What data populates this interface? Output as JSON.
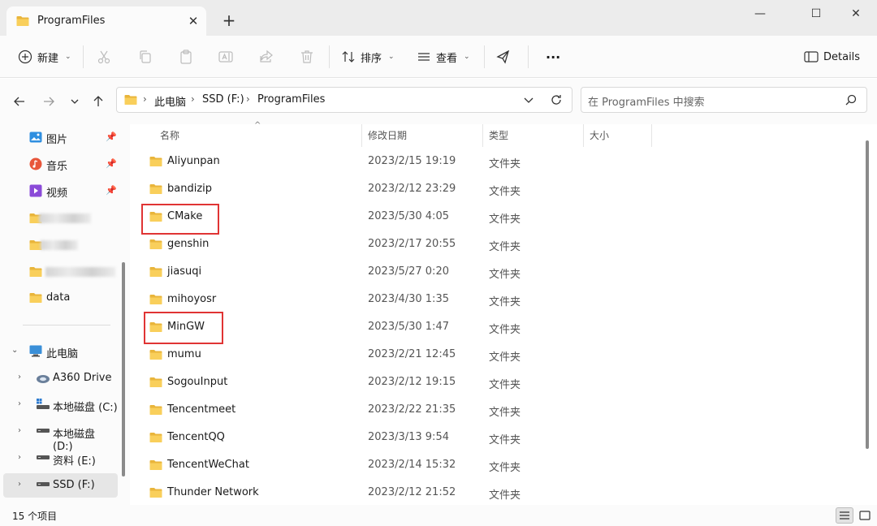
{
  "window": {
    "tab_title": "ProgramFiles",
    "tab_close": "✕",
    "new_tab": "+",
    "minimize": "—",
    "maximize": "☐",
    "close": "✕"
  },
  "toolbar": {
    "new_label": "新建",
    "sort_label": "排序",
    "view_label": "查看",
    "more_label": "···",
    "details_label": "Details"
  },
  "address": {
    "crumbs": [
      "此电脑",
      "SSD (F:)",
      "ProgramFiles"
    ],
    "search_placeholder": "在 ProgramFiles 中搜索"
  },
  "sidebar": {
    "quick": [
      {
        "label": "图片",
        "icon": "pictures-icon"
      },
      {
        "label": "音乐",
        "icon": "music-icon"
      },
      {
        "label": "视频",
        "icon": "videos-icon"
      }
    ],
    "data_folder": "data",
    "this_pc": "此电脑",
    "drives": [
      {
        "label": "A360 Drive",
        "icon": "cloud-drive-icon"
      },
      {
        "label": "本地磁盘 (C:)",
        "icon": "drive-icon"
      },
      {
        "label": "本地磁盘 (D:)",
        "icon": "drive-icon"
      },
      {
        "label": "资料 (E:)",
        "icon": "drive-icon"
      },
      {
        "label": "SSD (F:)",
        "icon": "drive-icon",
        "selected": true
      }
    ]
  },
  "columns": {
    "name": "名称",
    "date": "修改日期",
    "type": "类型",
    "size": "大小"
  },
  "files": [
    {
      "name": "Aliyunpan",
      "date": "2023/2/15 19:19",
      "type": "文件夹"
    },
    {
      "name": "bandizip",
      "date": "2023/2/12 23:29",
      "type": "文件夹"
    },
    {
      "name": "CMake",
      "date": "2023/5/30 4:05",
      "type": "文件夹",
      "highlighted": true
    },
    {
      "name": "genshin",
      "date": "2023/2/17 20:55",
      "type": "文件夹"
    },
    {
      "name": "jiasuqi",
      "date": "2023/5/27 0:20",
      "type": "文件夹"
    },
    {
      "name": "mihoyosr",
      "date": "2023/4/30 1:35",
      "type": "文件夹"
    },
    {
      "name": "MinGW",
      "date": "2023/5/30 1:47",
      "type": "文件夹",
      "highlighted": true
    },
    {
      "name": "mumu",
      "date": "2023/2/21 12:45",
      "type": "文件夹"
    },
    {
      "name": "SogouInput",
      "date": "2023/2/12 19:15",
      "type": "文件夹"
    },
    {
      "name": "Tencentmeet",
      "date": "2023/2/22 21:35",
      "type": "文件夹"
    },
    {
      "name": "TencentQQ",
      "date": "2023/3/13 9:54",
      "type": "文件夹"
    },
    {
      "name": "TencentWeChat",
      "date": "2023/2/14 15:32",
      "type": "文件夹"
    },
    {
      "name": "Thunder Network",
      "date": "2023/2/12 21:52",
      "type": "文件夹"
    }
  ],
  "status": {
    "item_count": "15 个项目"
  },
  "colors": {
    "folder": "#f7c744",
    "highlight": "#e03434",
    "accent": "#0067c0"
  }
}
